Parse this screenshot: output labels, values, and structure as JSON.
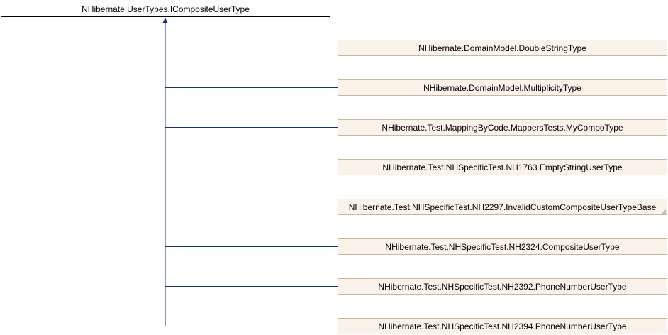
{
  "base_class": "NHibernate.UserTypes.ICompositeUserType",
  "derived_classes": [
    "NHibernate.DomainModel.DoubleStringType",
    "NHibernate.DomainModel.MultiplicityType",
    "NHibernate.Test.MappingByCode.MappersTests.MyCompoType",
    "NHibernate.Test.NHSpecificTest.NH1763.EmptyStringUserType",
    "NHibernate.Test.NHSpecificTest.NH2297.InvalidCustomCompositeUserTypeBase",
    "NHibernate.Test.NHSpecificTest.NH2324.CompositeUserType",
    "NHibernate.Test.NHSpecificTest.NH2392.PhoneNumberUserType",
    "NHibernate.Test.NHSpecificTest.NH2394.PhoneNumberUserType"
  ],
  "colors": {
    "line": "#1c2f7a",
    "derived_fill": "#fbf3ea",
    "derived_border": "#c8b7a3"
  }
}
